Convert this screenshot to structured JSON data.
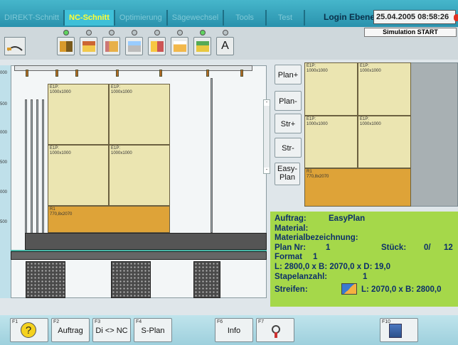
{
  "tabs": [
    {
      "label": "DIREKT-Schnitt",
      "active": false
    },
    {
      "label": "NC-Schnitt",
      "active": true
    },
    {
      "label": "Optimierung",
      "active": false
    },
    {
      "label": "Sägewechsel",
      "active": false
    },
    {
      "label": "Tools",
      "active": false
    },
    {
      "label": "Test",
      "active": false
    }
  ],
  "header": {
    "login": "Login Ebene1",
    "datetime": "25.04.2005  08:58:26",
    "simulation": "Simulation START"
  },
  "toolbar": {
    "a_label": "A",
    "icons": [
      "saw-layout-icon",
      "stack-icon",
      "transfer-icon",
      "cleaning-icon",
      "table-icon",
      "printer-icon",
      "stack-up-icon",
      "letter-a-icon"
    ]
  },
  "axis": {
    "ticks": [
      "000",
      "500",
      "000",
      "500",
      "000",
      "500"
    ]
  },
  "left_sheets": [
    {
      "label": "E1P:",
      "size": "1000x1000"
    },
    {
      "label": "E1P:",
      "size": "1000x1000"
    },
    {
      "label": "E1P:",
      "size": "1000x1000"
    },
    {
      "label": "E1P:",
      "size": "1000x1000"
    },
    {
      "label": "R1",
      "size": "770,8x2070"
    }
  ],
  "right_sheets": [
    {
      "label": "E1P:",
      "size": "1000x1000"
    },
    {
      "label": "E1P:",
      "size": "1000x1000"
    },
    {
      "label": "E1P:",
      "size": "1000x1000"
    },
    {
      "label": "E1P:",
      "size": "1000x1000"
    },
    {
      "label": "R1",
      "size": "770,8x2070"
    }
  ],
  "side_buttons": {
    "plan_plus": "Plan+",
    "plan_minus": "Plan-",
    "str_plus": "Str+",
    "str_minus": "Str-",
    "easy_plan": "Easy-Plan"
  },
  "scroll": {
    "up": "-",
    "down": "-"
  },
  "info": {
    "auftrag_label": "Auftrag:",
    "auftrag_value": "EasyPlan",
    "material_label": "Material:",
    "materialbez_label": "Materialbezeichnung:",
    "plan_label": "Plan Nr:",
    "plan_value": "1",
    "stueck_label": "Stück:",
    "stueck_value": "0/",
    "stueck_total": "12",
    "format_label": "Format",
    "format_value": "1",
    "dims": "L:  2800,0 x B:  2070,0 x D:  19,0",
    "stapel_label": "Stapelanzahl:",
    "stapel_value": "1",
    "streifen_label": "Streifen:",
    "streifen_dims": "L:  2070,0 x B:  2800,0"
  },
  "fkeys": [
    {
      "key": "F1",
      "label": "?"
    },
    {
      "key": "F2",
      "label": "Auftrag"
    },
    {
      "key": "F3",
      "label": "Di <> NC"
    },
    {
      "key": "F4",
      "label": "S-Plan"
    },
    {
      "key": "F6",
      "label": "Info"
    },
    {
      "key": "F7",
      "label": ""
    },
    {
      "key": "F10",
      "label": ""
    }
  ]
}
